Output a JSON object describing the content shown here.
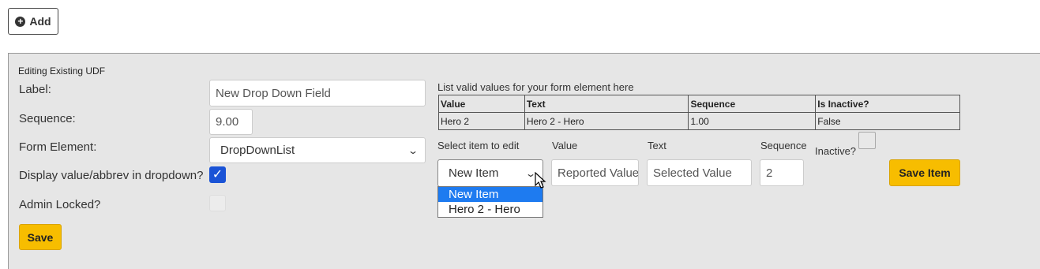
{
  "toolbar": {
    "add_label": "Add",
    "add_icon": "plus-circle-icon"
  },
  "panel": {
    "title": "Editing Existing UDF",
    "label_label": "Label:",
    "label_value": "New Drop Down Field",
    "sequence_label": "Sequence:",
    "sequence_value": "9.00",
    "form_element_label": "Form Element:",
    "form_element_value": "DropDownList",
    "display_value_label": "Display value/abbrev in dropdown?",
    "display_value_checked": true,
    "admin_locked_label": "Admin Locked?",
    "admin_locked_checked": false,
    "save_label": "Save"
  },
  "values_editor": {
    "hint": "List valid values for your form element here",
    "columns": [
      "Value",
      "Text",
      "Sequence",
      "Is Inactive?"
    ],
    "rows": [
      {
        "value": "Hero 2",
        "text": "Hero 2 - Hero",
        "sequence": "1.00",
        "inactive": "False"
      }
    ],
    "select_label": "Select item to edit",
    "select_value": "New Item",
    "select_options": [
      "New Item",
      "Hero 2 - Hero"
    ],
    "value_label": "Value",
    "value_placeholder": "Reported Value",
    "text_label": "Text",
    "text_placeholder": "Selected Value",
    "sequence_label": "Sequence",
    "sequence_value": "2",
    "inactive_label": "Inactive?",
    "save_item_label": "Save Item"
  },
  "colors": {
    "accent": "#f7bd00",
    "checkbox": "#1a53d6",
    "highlight": "#1e7bf0",
    "panel_bg": "#e6e6e6"
  }
}
